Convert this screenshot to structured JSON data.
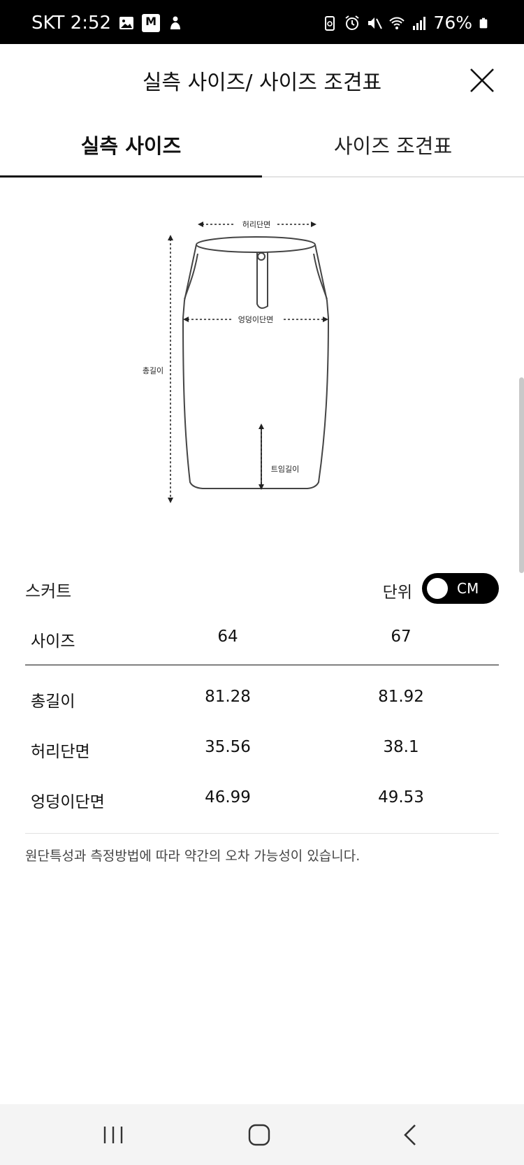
{
  "status_bar": {
    "carrier_time": "SKT 2:52",
    "stock_badge": "M",
    "battery": "76%"
  },
  "header": {
    "title": "실측 사이즈/ 사이즈 조견표"
  },
  "tabs": [
    {
      "label": "실측 사이즈",
      "active": true
    },
    {
      "label": "사이즈 조견표",
      "active": false
    }
  ],
  "diagram": {
    "waist_label": "허리단면",
    "hip_label": "엉덩이단면",
    "length_label": "총길이",
    "slit_label": "트임길이"
  },
  "size_section": {
    "title": "스커트",
    "unit_label": "단위",
    "unit_value": "CM"
  },
  "size_table": {
    "header": {
      "label": "사이즈",
      "col1": "64",
      "col2": "67"
    },
    "rows": [
      {
        "label": "총길이",
        "col1": "81.28",
        "col2": "81.92"
      },
      {
        "label": "허리단면",
        "col1": "35.56",
        "col2": "38.1"
      },
      {
        "label": "엉덩이단면",
        "col1": "46.99",
        "col2": "49.53"
      }
    ]
  },
  "notice": "원단특성과 측정방법에 따라 약간의 오차 가능성이 있습니다."
}
